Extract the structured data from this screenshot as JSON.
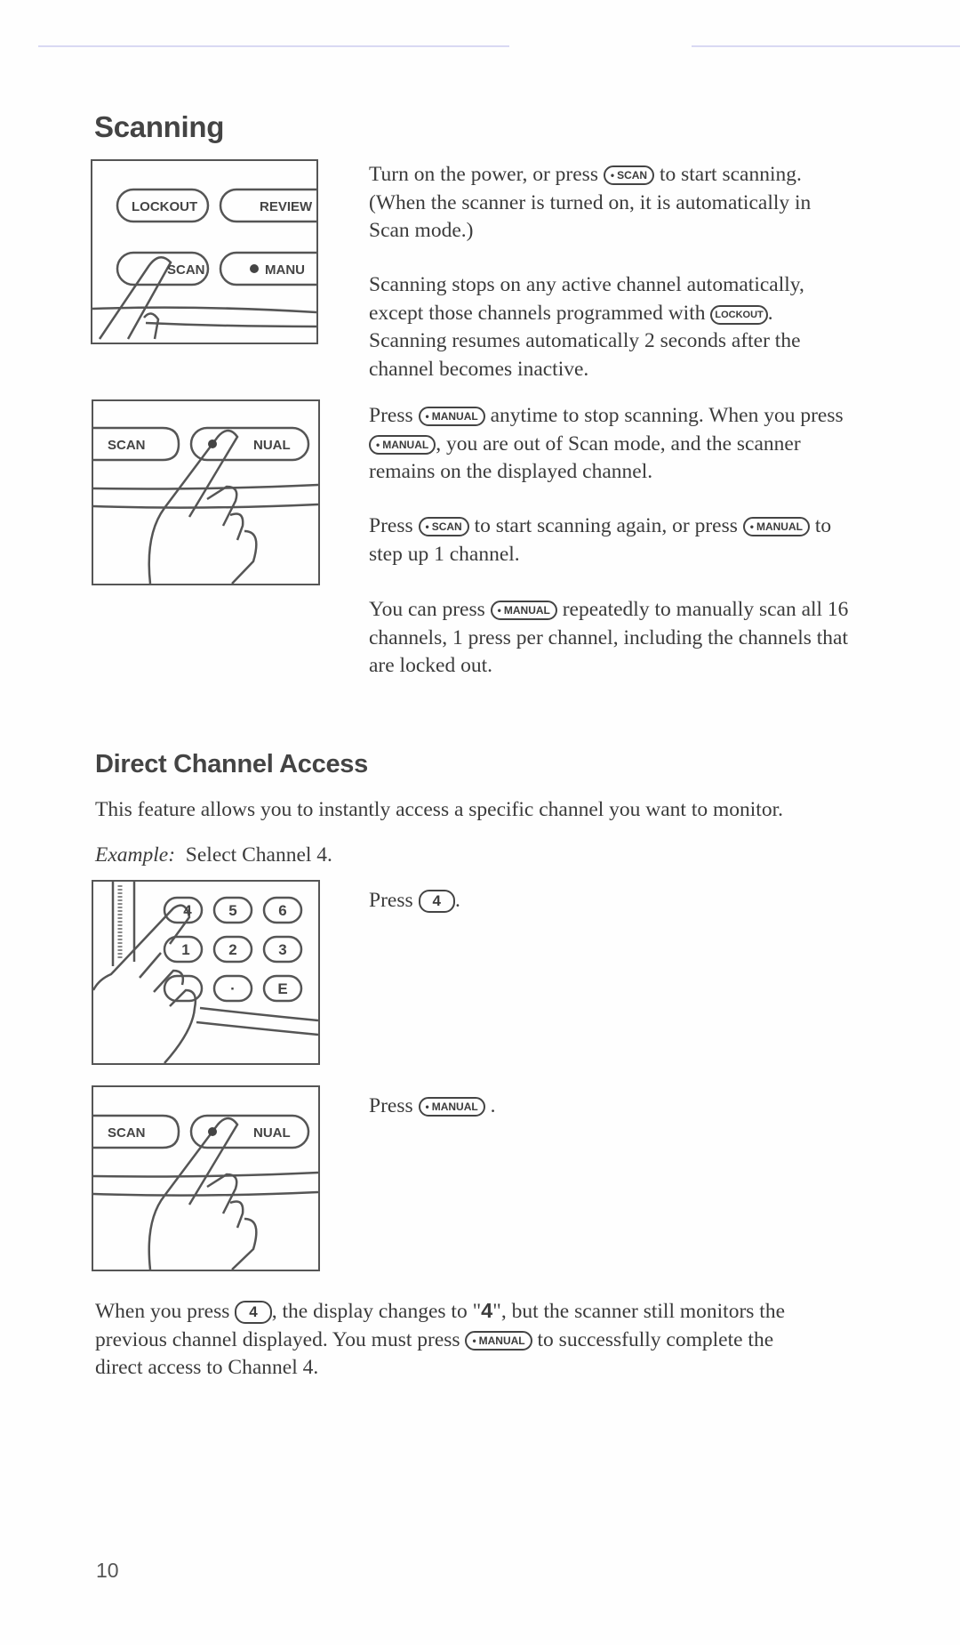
{
  "page_number": "10",
  "sections": {
    "scanning": {
      "title": "Scanning",
      "illustrations": [
        {
          "name": "scan-button-press",
          "keys": [
            "LOCKOUT",
            "REVIEW",
            "SCAN",
            "MANU"
          ]
        },
        {
          "name": "manual-button-press",
          "keys": [
            "SCAN",
            "NUAL"
          ]
        }
      ],
      "paragraphs": [
        {
          "parts": [
            "Turn on the power, or press ",
            " to start scanning.",
            "(When the scanner is turned on, it is automatically in",
            "Scan mode.)"
          ],
          "keys": [
            "SCAN"
          ]
        },
        {
          "parts": [
            "Scanning stops on any active channel automatically,",
            "except those channels programmed with ",
            ".",
            "Scanning resumes automatically 2 seconds after the",
            "channel becomes inactive."
          ],
          "keys": [
            "LOCKOUT"
          ]
        },
        {
          "parts": [
            "Press ",
            " anytime to stop scanning.  When you press",
            ", you are out of Scan mode, and the scanner",
            "remains on the displayed channel."
          ],
          "keys": [
            "MANUAL",
            "MANUAL"
          ]
        },
        {
          "parts": [
            "Press ",
            " to start scanning again, or press ",
            " to",
            "step up 1 channel."
          ],
          "keys": [
            "SCAN",
            "MANUAL"
          ]
        },
        {
          "parts": [
            "You can press ",
            " repeatedly to manually scan all 16",
            "channels, 1 press per channel, including the channels that",
            "are locked out."
          ],
          "keys": [
            "MANUAL"
          ]
        }
      ]
    },
    "direct_access": {
      "title": "Direct Channel Access",
      "intro": "This feature allows you to instantly access a specific channel you want to monitor.",
      "example_label": "Example:",
      "example_text": "Select Channel 4.",
      "illustrations": [
        {
          "name": "keypad-press",
          "keys": [
            "4",
            "5",
            "6",
            "1",
            "2",
            "3",
            "·",
            "E"
          ]
        },
        {
          "name": "manual-button-press",
          "keys": [
            "SCAN",
            "NUAL"
          ]
        }
      ],
      "steps": [
        {
          "prefix": "Press ",
          "key": "4",
          "suffix": "."
        },
        {
          "prefix": "Press ",
          "key": "MANUAL",
          "suffix": " ."
        }
      ],
      "closing": {
        "parts": [
          "When you press ",
          ", the display changes to \"",
          "4",
          "\", but the scanner still monitors the",
          "previous channel displayed.  You must press ",
          " to successfully complete the",
          "direct access to Channel 4."
        ],
        "keys": [
          "4",
          "MANUAL"
        ]
      }
    }
  }
}
